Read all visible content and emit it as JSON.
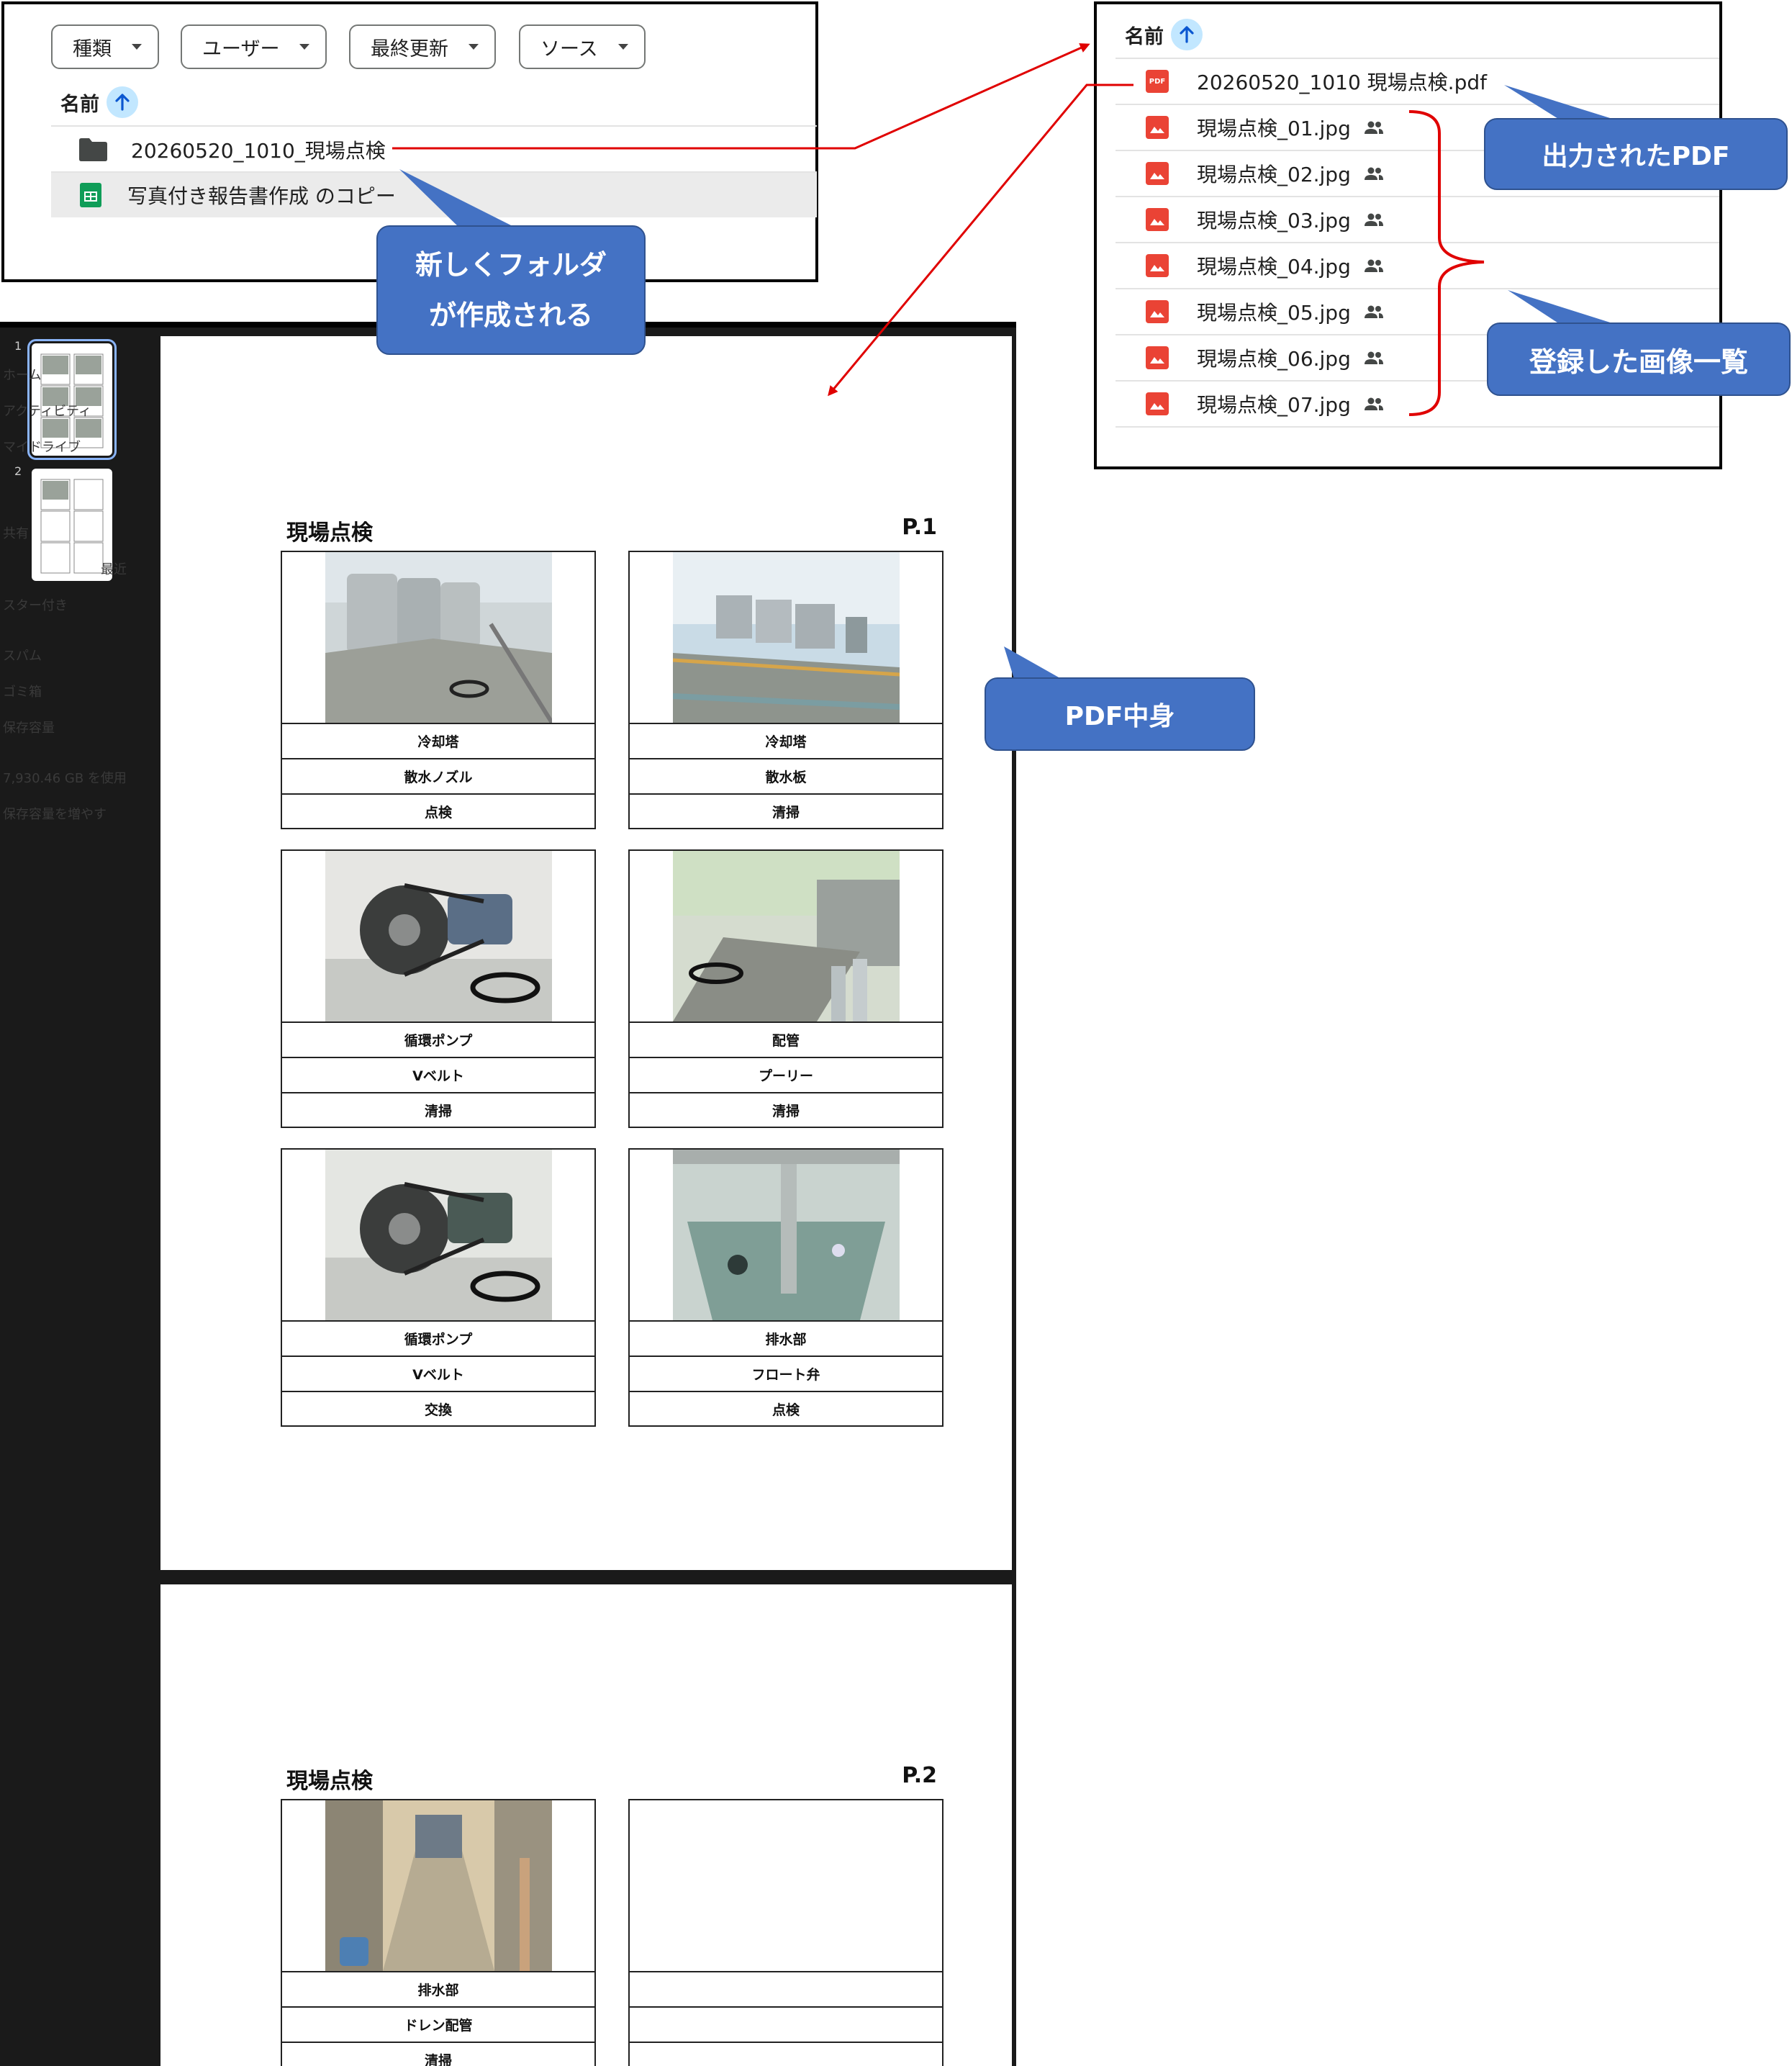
{
  "drive_folder_view": {
    "filters": [
      "種類",
      "ユーザー",
      "最終更新",
      "ソース"
    ],
    "column_name": "名前",
    "rows": [
      {
        "name": "20260520_1010_現場点検",
        "type": "folder"
      },
      {
        "name": "写真付き報告書作成 のコピー",
        "type": "sheets"
      }
    ]
  },
  "drive_file_list": {
    "column_name": "名前",
    "files": [
      {
        "name": "20260520_1010 現場点検.pdf",
        "type": "pdf",
        "pdf_label": "PDF"
      },
      {
        "name": "現場点検_01.jpg",
        "type": "image"
      },
      {
        "name": "現場点検_02.jpg",
        "type": "image"
      },
      {
        "name": "現場点検_03.jpg",
        "type": "image"
      },
      {
        "name": "現場点検_04.jpg",
        "type": "image"
      },
      {
        "name": "現場点検_05.jpg",
        "type": "image"
      },
      {
        "name": "現場点検_06.jpg",
        "type": "image"
      },
      {
        "name": "現場点検_07.jpg",
        "type": "image"
      }
    ]
  },
  "viewer": {
    "thumbnails": [
      "1",
      "2"
    ],
    "sidebar_ghost_text": [
      "ホーム",
      "アクティビティ",
      "マイドライブ",
      "共有",
      "最近",
      "スター付き",
      "スパム",
      "ゴミ箱",
      "保存容量",
      "7,930.46 GB を使用",
      "保存容量を増やす"
    ],
    "pages": [
      {
        "title": "現場点検",
        "page_number": "P.1",
        "cards": [
          {
            "image": "cooling-tower-photo",
            "labels": [
              "冷却塔",
              "散水ノズル",
              "点検"
            ]
          },
          {
            "image": "rooftop-units-photo",
            "labels": [
              "冷却塔",
              "散水板",
              "清掃"
            ]
          },
          {
            "image": "pump-motor-photo",
            "labels": [
              "循環ポンプ",
              "Vベルト",
              "清掃"
            ]
          },
          {
            "image": "piping-photo",
            "labels": [
              "配管",
              "プーリー",
              "清掃"
            ]
          },
          {
            "image": "pump-belt-photo",
            "labels": [
              "循環ポンプ",
              "Vベルト",
              "交換"
            ]
          },
          {
            "image": "drain-basin-photo",
            "labels": [
              "排水部",
              "フロート弁",
              "点検"
            ]
          }
        ]
      },
      {
        "title": "現場点検",
        "page_number": "P.2",
        "cards": [
          {
            "image": "drain-corridor-photo",
            "labels": [
              "排水部",
              "ドレン配管",
              "清掃"
            ]
          },
          {
            "image": "",
            "labels": [
              "",
              "",
              ""
            ]
          }
        ]
      }
    ]
  },
  "callouts": {
    "new_folder": [
      "新しくフォルダ",
      "が作成される"
    ],
    "output_pdf": "出力されたPDF",
    "image_list": "登録した画像一覧",
    "pdf_content": "PDF中身"
  },
  "colors": {
    "callout": "#4472c4",
    "arrow": "#e00000",
    "sort_badge": "#c2e7ff",
    "file_icon_red": "#ea4335",
    "sheets_green": "#0f9d58"
  }
}
